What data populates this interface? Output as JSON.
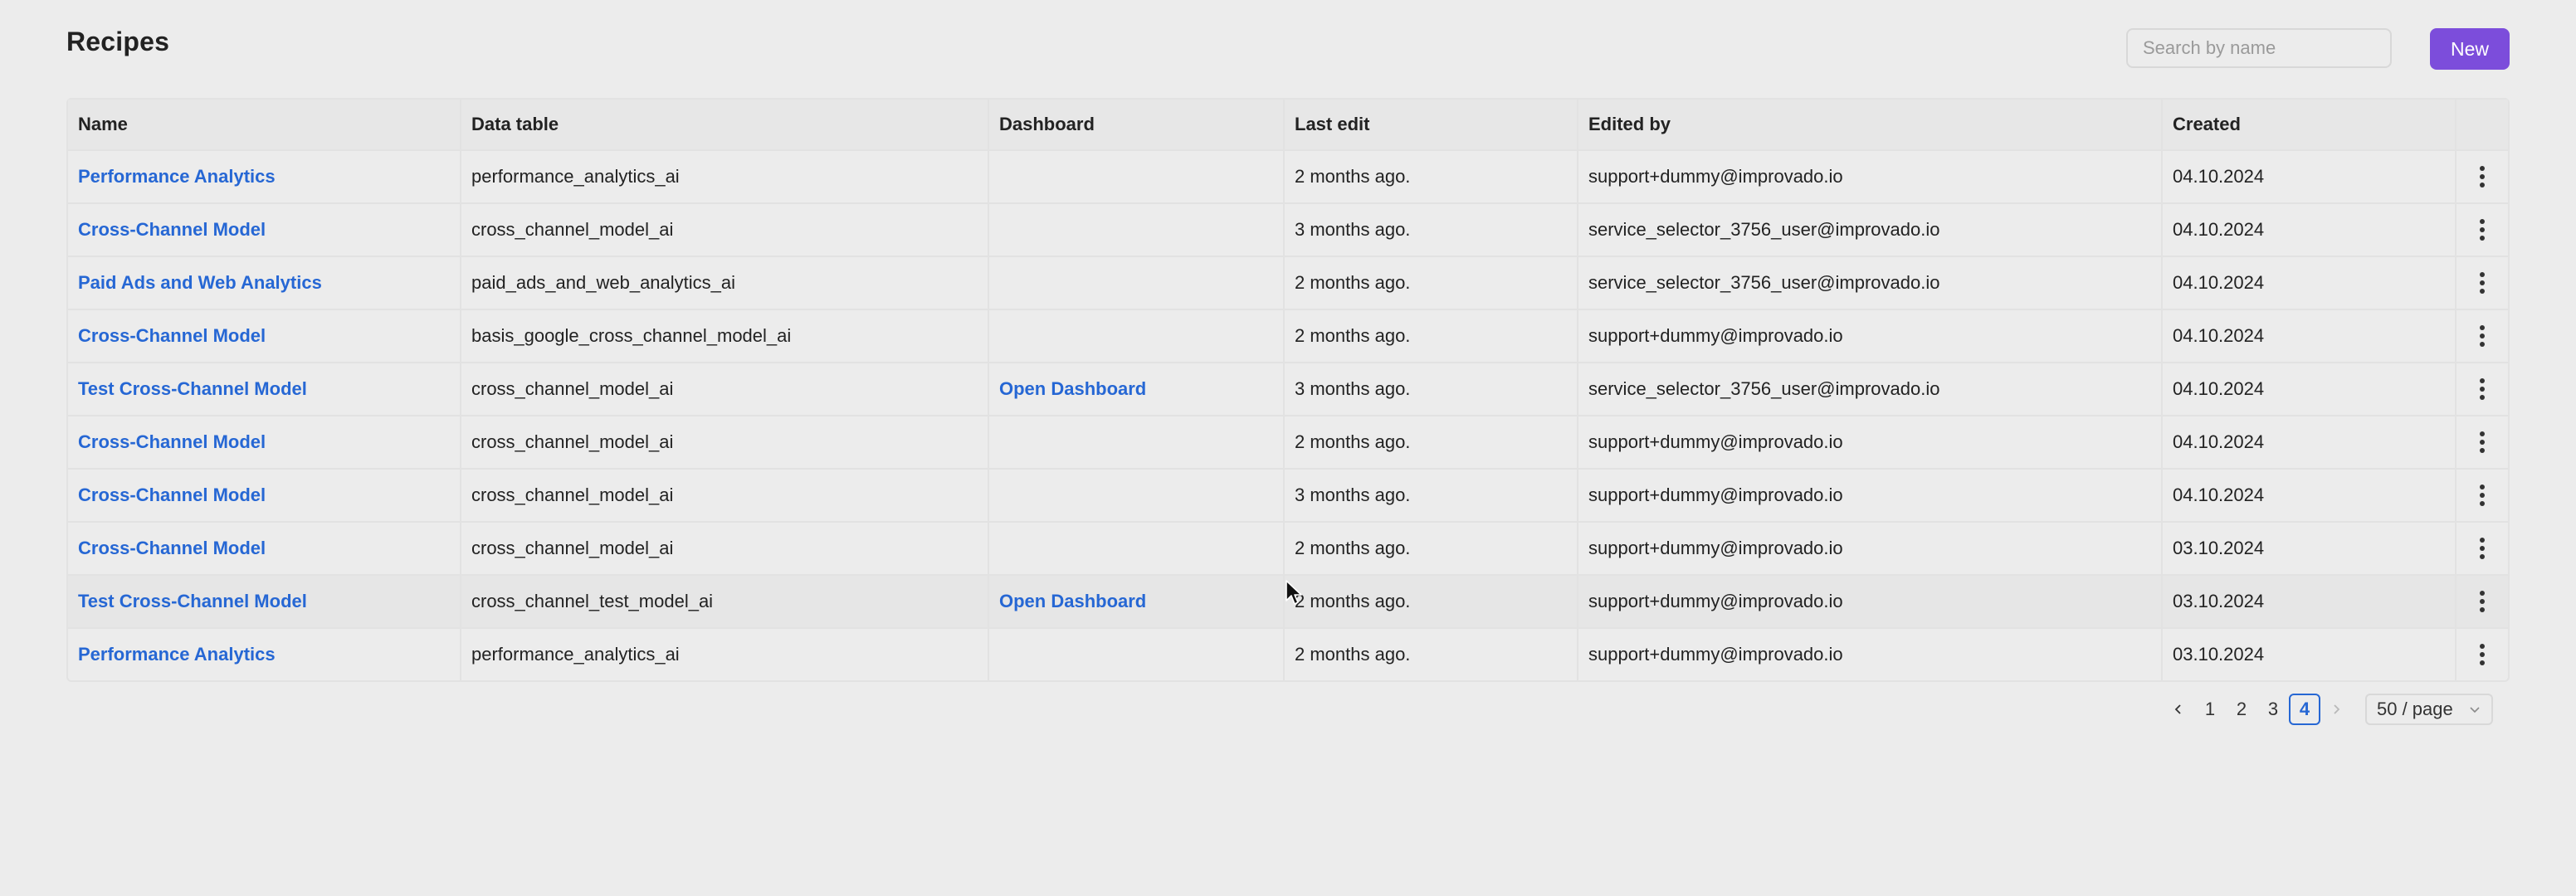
{
  "page": {
    "title": "Recipes"
  },
  "search": {
    "placeholder": "Search by name",
    "value": ""
  },
  "toolbar": {
    "new_label": "New"
  },
  "table": {
    "columns": [
      "Name",
      "Data table",
      "Dashboard",
      "Last edit",
      "Edited by",
      "Created"
    ],
    "rows": [
      {
        "name": "Performance Analytics",
        "data_table": "performance_analytics_ai",
        "dashboard": "",
        "last_edit": "2 months ago.",
        "edited_by": "support+dummy@improvado.io",
        "created": "04.10.2024"
      },
      {
        "name": "Cross-Channel Model",
        "data_table": "cross_channel_model_ai",
        "dashboard": "",
        "last_edit": "3 months ago.",
        "edited_by": "service_selector_3756_user@improvado.io",
        "created": "04.10.2024"
      },
      {
        "name": "Paid Ads and Web Analytics",
        "data_table": "paid_ads_and_web_analytics_ai",
        "dashboard": "",
        "last_edit": "2 months ago.",
        "edited_by": "service_selector_3756_user@improvado.io",
        "created": "04.10.2024"
      },
      {
        "name": "Cross-Channel Model",
        "data_table": "basis_google_cross_channel_model_ai",
        "dashboard": "",
        "last_edit": "2 months ago.",
        "edited_by": "support+dummy@improvado.io",
        "created": "04.10.2024"
      },
      {
        "name": "Test Cross-Channel Model",
        "data_table": "cross_channel_model_ai",
        "dashboard": "Open Dashboard",
        "last_edit": "3 months ago.",
        "edited_by": "service_selector_3756_user@improvado.io",
        "created": "04.10.2024"
      },
      {
        "name": "Cross-Channel Model",
        "data_table": "cross_channel_model_ai",
        "dashboard": "",
        "last_edit": "2 months ago.",
        "edited_by": "support+dummy@improvado.io",
        "created": "04.10.2024"
      },
      {
        "name": "Cross-Channel Model",
        "data_table": "cross_channel_model_ai",
        "dashboard": "",
        "last_edit": "3 months ago.",
        "edited_by": "support+dummy@improvado.io",
        "created": "04.10.2024"
      },
      {
        "name": "Cross-Channel Model",
        "data_table": "cross_channel_model_ai",
        "dashboard": "",
        "last_edit": "2 months ago.",
        "edited_by": "support+dummy@improvado.io",
        "created": "03.10.2024"
      },
      {
        "name": "Test Cross-Channel Model",
        "data_table": "cross_channel_test_model_ai",
        "dashboard": "Open Dashboard",
        "last_edit": "2 months ago.",
        "edited_by": "support+dummy@improvado.io",
        "created": "03.10.2024"
      },
      {
        "name": "Performance Analytics",
        "data_table": "performance_analytics_ai",
        "dashboard": "",
        "last_edit": "2 months ago.",
        "edited_by": "support+dummy@improvado.io",
        "created": "03.10.2024"
      }
    ],
    "hovered_row": 8
  },
  "pagination": {
    "pages": [
      "1",
      "2",
      "3",
      "4"
    ],
    "current": "4",
    "page_size": "50 / page"
  },
  "icons": {
    "search": "search-icon",
    "row_menu": "more-vertical-icon",
    "prev": "chevron-left-icon",
    "next": "chevron-right-icon",
    "dropdown": "chevron-down-icon",
    "cursor": "mouse-pointer-icon"
  },
  "colors": {
    "accent": "#7c4ddb",
    "link": "#2667d4",
    "background": "#ececec"
  }
}
